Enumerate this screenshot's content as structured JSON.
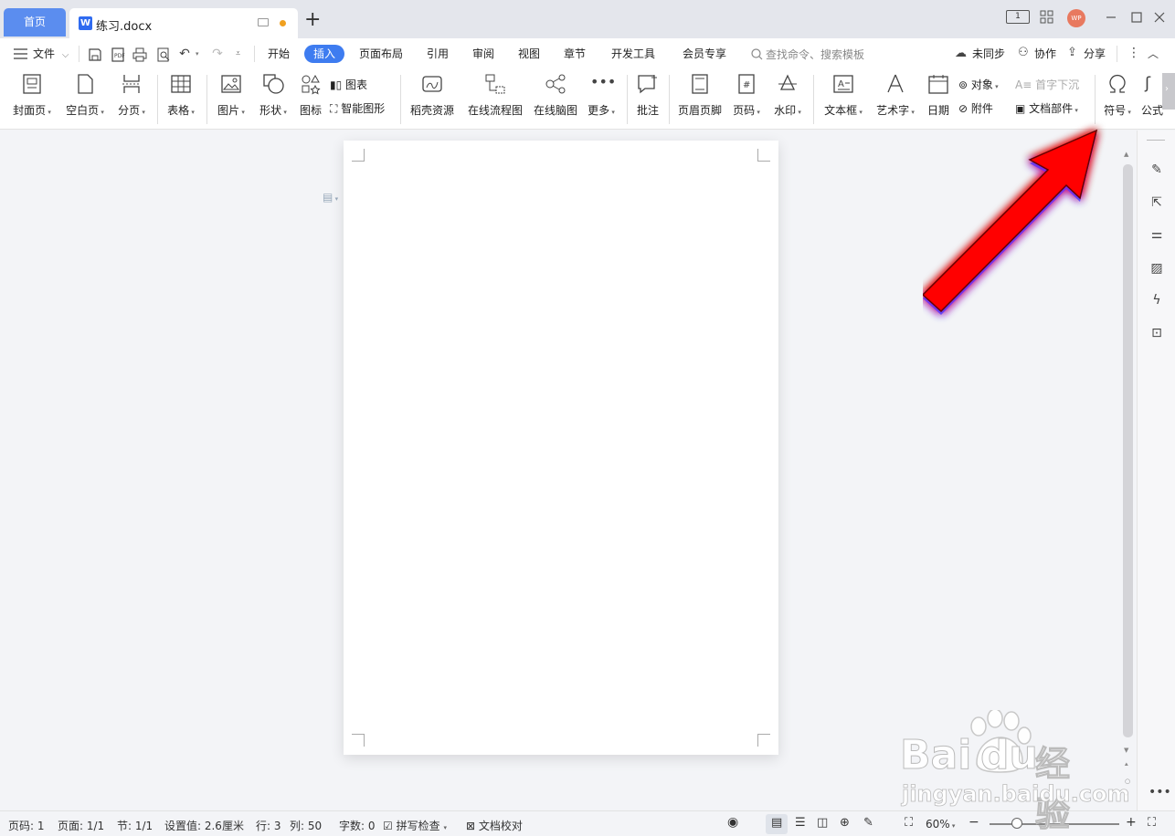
{
  "titlebar": {
    "home_tab": "首页",
    "doc_tab": "练习.docx",
    "doc_icon": "W",
    "add_tab": "+",
    "page_counter": "1",
    "avatar_text": "WP"
  },
  "menu": {
    "file_label": "文件",
    "tabs": [
      "开始",
      "插入",
      "页面布局",
      "引用",
      "审阅",
      "视图",
      "章节",
      "开发工具",
      "会员专享"
    ],
    "active_tab": "插入",
    "search_placeholder": "查找命令、搜索模板",
    "sync_label": "未同步",
    "collab_label": "协作",
    "share_label": "分享"
  },
  "ribbon": {
    "cover": "封面页",
    "blank": "空白页",
    "pagebreak": "分页",
    "table": "表格",
    "picture": "图片",
    "shape": "形状",
    "icon": "图标",
    "chart": "图表",
    "smartart": "智能图形",
    "daoke": "稻壳资源",
    "flowchart": "在线流程图",
    "mindmap": "在线脑图",
    "more": "更多",
    "comment": "批注",
    "header_footer": "页眉页脚",
    "page_number": "页码",
    "watermark": "水印",
    "textbox": "文本框",
    "wordart": "艺术字",
    "date": "日期",
    "object": "对象",
    "attachment": "附件",
    "dropcap": "首字下沉",
    "doc_parts": "文档部件",
    "symbol": "符号",
    "formula": "公式"
  },
  "status": {
    "page_num": "页码: 1",
    "pages": "页面: 1/1",
    "section": "节: 1/1",
    "setting": "设置值: 2.6厘米",
    "row": "行: 3",
    "col": "列: 50",
    "words": "字数: 0",
    "spell": "拼写检查",
    "proof": "文档校对",
    "zoom": "60%",
    "zoom_level": 0.6
  },
  "watermark": {
    "brand": "Bai",
    "brand2": "du",
    "cn": "经验",
    "url": "jingyan.baidu.com"
  },
  "colors": {
    "accent": "#3e7cf0",
    "home_tab": "#5b8def",
    "arrow": "#ff0000",
    "arrow_glow": "#1a2cff"
  }
}
